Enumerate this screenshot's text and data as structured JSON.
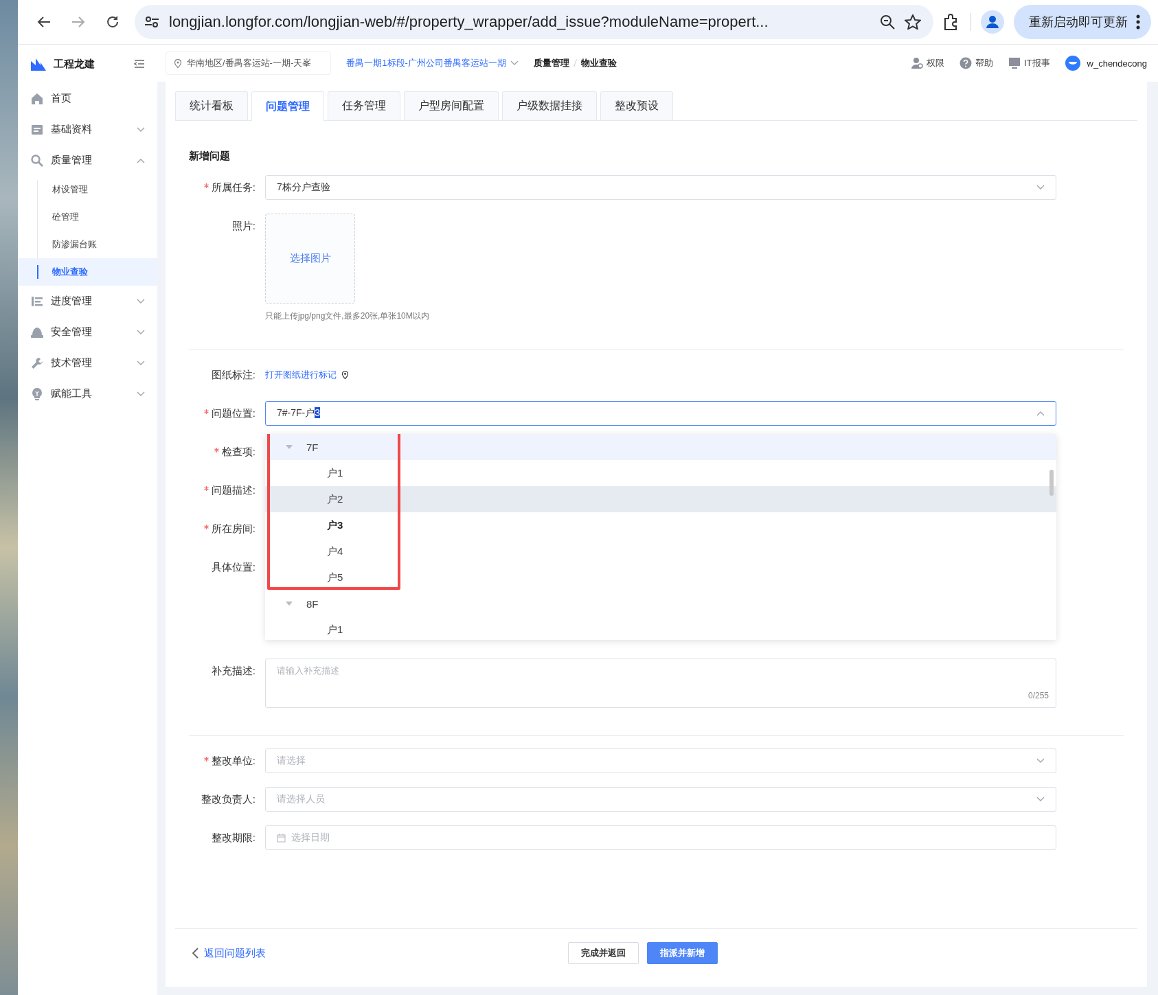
{
  "browser": {
    "url": "longjian.longfor.com/longjian-web/#/property_wrapper/add_issue?moduleName=propert...",
    "update_button": "重新启动即可更新"
  },
  "sidebar": {
    "app_name": "工程龙建",
    "items": [
      {
        "label": "首页"
      },
      {
        "label": "基础资料",
        "expanded": false
      },
      {
        "label": "质量管理",
        "expanded": true,
        "children": [
          {
            "label": "材设管理",
            "selected": false
          },
          {
            "label": "砼管理",
            "selected": false
          },
          {
            "label": "防渗漏台账",
            "selected": false
          },
          {
            "label": "物业查验",
            "selected": true
          }
        ]
      },
      {
        "label": "进度管理",
        "expanded": false
      },
      {
        "label": "安全管理",
        "expanded": false
      },
      {
        "label": "技术管理",
        "expanded": false
      },
      {
        "label": "赋能工具",
        "expanded": false
      }
    ]
  },
  "header": {
    "location": "华南地区/番禺客运站-一期-天峯",
    "project": "番禺一期1标段-广州公司番禺客运站一期",
    "breadcrumb": [
      "质量管理",
      "物业查验"
    ],
    "actions": [
      "权限",
      "帮助",
      "IT报事"
    ],
    "user": "w_chendecong"
  },
  "tabs": [
    {
      "label": "统计看板",
      "selected": false
    },
    {
      "label": "问题管理",
      "selected": true
    },
    {
      "label": "任务管理",
      "selected": false
    },
    {
      "label": "户型房间配置",
      "selected": false
    },
    {
      "label": "户级数据挂接",
      "selected": false
    },
    {
      "label": "整改预设",
      "selected": false
    }
  ],
  "form": {
    "title": "新增问题",
    "sections": [
      [
        {
          "kind": "select",
          "label": "所属任务:",
          "required": true,
          "value": "7栋分户查验"
        },
        {
          "kind": "upload",
          "label": "照片:",
          "required": false,
          "button": "选择图片",
          "hint": "只能上传jpg/png文件,最多20张,单张10M以内"
        }
      ],
      [
        {
          "kind": "link",
          "label": "图纸标注:",
          "required": false,
          "link": "打开图纸进行标记"
        },
        {
          "kind": "cascader",
          "label": "问题位置:",
          "required": true,
          "value": "7#-7F-户",
          "selected_text": "3",
          "expanded": true,
          "options": [
            {
              "label": "7F",
              "expanded": true,
              "active": true,
              "children": [
                {
                  "label": "户1",
                  "selected": false,
                  "hovered": false
                },
                {
                  "label": "户2",
                  "selected": false,
                  "hovered": true
                },
                {
                  "label": "户3",
                  "selected": true,
                  "hovered": false
                },
                {
                  "label": "户4",
                  "selected": false,
                  "hovered": false
                },
                {
                  "label": "户5",
                  "selected": false,
                  "hovered": false
                }
              ]
            },
            {
              "label": "8F",
              "expanded": true,
              "active": false,
              "children": [
                {
                  "label": "户1",
                  "selected": false,
                  "hovered": false
                }
              ]
            }
          ]
        },
        {
          "kind": "covered",
          "label": "检查项:",
          "required": true
        },
        {
          "kind": "covered",
          "label": "问题描述:",
          "required": true
        },
        {
          "kind": "covered",
          "label": "所在房间:",
          "required": true
        },
        {
          "kind": "covered",
          "label": "具体位置:",
          "required": false
        },
        {
          "kind": "textarea",
          "label": "补充描述:",
          "required": false,
          "placeholder": "请输入补充描述",
          "counter": "0/255"
        }
      ],
      [
        {
          "kind": "select",
          "label": "整改单位:",
          "required": true,
          "placeholder": "请选择"
        },
        {
          "kind": "select",
          "label": "整改负责人:",
          "required": false,
          "placeholder": "请选择人员"
        },
        {
          "kind": "date",
          "label": "整改期限:",
          "required": false,
          "placeholder": "选择日期"
        }
      ]
    ]
  },
  "footer": {
    "back_link": "返回问题列表",
    "buttons": [
      {
        "label": "完成并返回",
        "primary": false
      },
      {
        "label": "指派并新增",
        "primary": true
      }
    ]
  }
}
